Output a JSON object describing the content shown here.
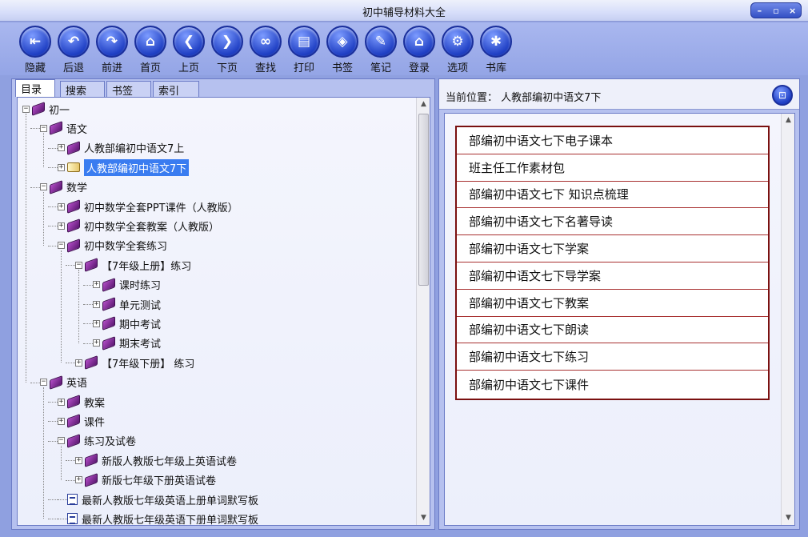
{
  "window": {
    "title": "初中辅导材料大全",
    "controls": [
      "–",
      "▫",
      "×"
    ]
  },
  "toolbar": [
    {
      "label": "隐藏",
      "icon": "hide-icon",
      "glyph": "⇤"
    },
    {
      "label": "后退",
      "icon": "back-icon",
      "glyph": "↶"
    },
    {
      "label": "前进",
      "icon": "forward-icon",
      "glyph": "↷"
    },
    {
      "label": "首页",
      "icon": "home-icon",
      "glyph": "⌂"
    },
    {
      "label": "上页",
      "icon": "prev-page-icon",
      "glyph": "❮"
    },
    {
      "label": "下页",
      "icon": "next-page-icon",
      "glyph": "❯"
    },
    {
      "label": "查找",
      "icon": "binoculars-icon",
      "glyph": "∞"
    },
    {
      "label": "打印",
      "icon": "printer-icon",
      "glyph": "▤"
    },
    {
      "label": "书签",
      "icon": "bookmark-tag-icon",
      "glyph": "◈"
    },
    {
      "label": "笔记",
      "icon": "notes-icon",
      "glyph": "✎"
    },
    {
      "label": "登录",
      "icon": "login-home-icon",
      "glyph": "⌂"
    },
    {
      "label": "选项",
      "icon": "gear-icon",
      "glyph": "⚙"
    },
    {
      "label": "书库",
      "icon": "library-icon",
      "glyph": "✱"
    }
  ],
  "tabs": [
    "目录",
    "搜索",
    "书签",
    "索引"
  ],
  "tree": [
    {
      "label": "初一",
      "level": 0,
      "toggle": "−",
      "icon": "book"
    },
    {
      "label": "语文",
      "level": 1,
      "toggle": "−",
      "icon": "book"
    },
    {
      "label": "人教部编初中语文7上",
      "level": 2,
      "toggle": "+",
      "icon": "book"
    },
    {
      "label": "人教部编初中语文7下",
      "level": 2,
      "toggle": "+",
      "icon": "open-book",
      "selected": true
    },
    {
      "label": "数学",
      "level": 1,
      "toggle": "−",
      "icon": "book"
    },
    {
      "label": "初中数学全套PPT课件（人教版）",
      "level": 2,
      "toggle": "+",
      "icon": "book"
    },
    {
      "label": "初中数学全套教案（人教版）",
      "level": 2,
      "toggle": "+",
      "icon": "book"
    },
    {
      "label": "初中数学全套练习",
      "level": 2,
      "toggle": "−",
      "icon": "book"
    },
    {
      "label": "【7年级上册】练习",
      "level": 3,
      "toggle": "−",
      "icon": "book"
    },
    {
      "label": "课时练习",
      "level": 4,
      "toggle": "+",
      "icon": "book"
    },
    {
      "label": "单元测试",
      "level": 4,
      "toggle": "+",
      "icon": "book"
    },
    {
      "label": "期中考试",
      "level": 4,
      "toggle": "+",
      "icon": "book"
    },
    {
      "label": "期末考试",
      "level": 4,
      "toggle": "+",
      "icon": "book"
    },
    {
      "label": "【7年级下册】 练习",
      "level": 3,
      "toggle": "+",
      "icon": "book"
    },
    {
      "label": "英语",
      "level": 1,
      "toggle": "−",
      "icon": "book"
    },
    {
      "label": "教案",
      "level": 2,
      "toggle": "+",
      "icon": "book"
    },
    {
      "label": "课件",
      "level": 2,
      "toggle": "+",
      "icon": "book"
    },
    {
      "label": "练习及试卷",
      "level": 2,
      "toggle": "−",
      "icon": "book"
    },
    {
      "label": "新版人教版七年级上英语试卷",
      "level": 3,
      "toggle": "+",
      "icon": "book"
    },
    {
      "label": "新版七年级下册英语试卷",
      "level": 3,
      "toggle": "+",
      "icon": "book"
    },
    {
      "label": "最新人教版七年级英语上册单词默写板",
      "level": 2,
      "toggle": "",
      "icon": "doc"
    },
    {
      "label": "最新人教版七年级英语下册单词默写板",
      "level": 2,
      "toggle": "",
      "icon": "doc"
    }
  ],
  "location": {
    "text": "当前位置： 人教部编初中语文7下"
  },
  "content_links": [
    "部编初中语文七下电子课本",
    "班主任工作素材包",
    "部编初中语文七下 知识点梳理",
    "部编初中语文七下名著导读",
    "部编初中语文七下学案",
    "部编初中语文七下导学案",
    "部编初中语文七下教案",
    "部编初中语文七下朗读",
    "部编初中语文七下练习",
    "部编初中语文七下课件"
  ]
}
